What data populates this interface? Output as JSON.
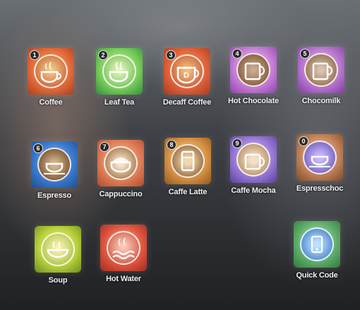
{
  "drinks": [
    {
      "number": "1",
      "label": "Coffee",
      "color": "#d8562e",
      "icon": "coffee-cup-icon"
    },
    {
      "number": "2",
      "label": "Leaf Tea",
      "color": "#4caf50",
      "icon": "tea-cup-icon"
    },
    {
      "number": "3",
      "label": "Decaff Coffee",
      "color": "#d9552f",
      "icon": "decaf-cup-icon"
    },
    {
      "number": "4",
      "label": "Hot Chocolate",
      "color": "#b768c9",
      "icon": "chocolate-mug-icon"
    },
    {
      "number": "5",
      "label": "Chocomilk",
      "color": "#a65ab8",
      "icon": "milk-mug-icon"
    },
    {
      "number": "6",
      "label": "Espresso",
      "color": "#2f6fb6",
      "icon": "espresso-cup-icon"
    },
    {
      "number": "7",
      "label": "Cappuccino",
      "color": "#d6684a",
      "icon": "cappuccino-cup-icon"
    },
    {
      "number": "8",
      "label": "Caffe Latte",
      "color": "#b5701f",
      "icon": "latte-glass-icon"
    },
    {
      "number": "9",
      "label": "Caffe Mocha",
      "color": "#7a62c2",
      "icon": "mocha-mug-icon"
    },
    {
      "number": "0",
      "label": "Espresschoc",
      "color": "#8a63b6",
      "icon": "espresschoc-cup-icon"
    },
    {
      "number": "",
      "label": "Soup",
      "color": "#93b826",
      "icon": "soup-bowl-icon"
    },
    {
      "number": "",
      "label": "Hot Water",
      "color": "#c8423a",
      "icon": "hot-water-icon"
    },
    {
      "number": "",
      "label": "Quick Code",
      "color": "#4b9b5c",
      "icon": "quick-code-icon"
    }
  ]
}
